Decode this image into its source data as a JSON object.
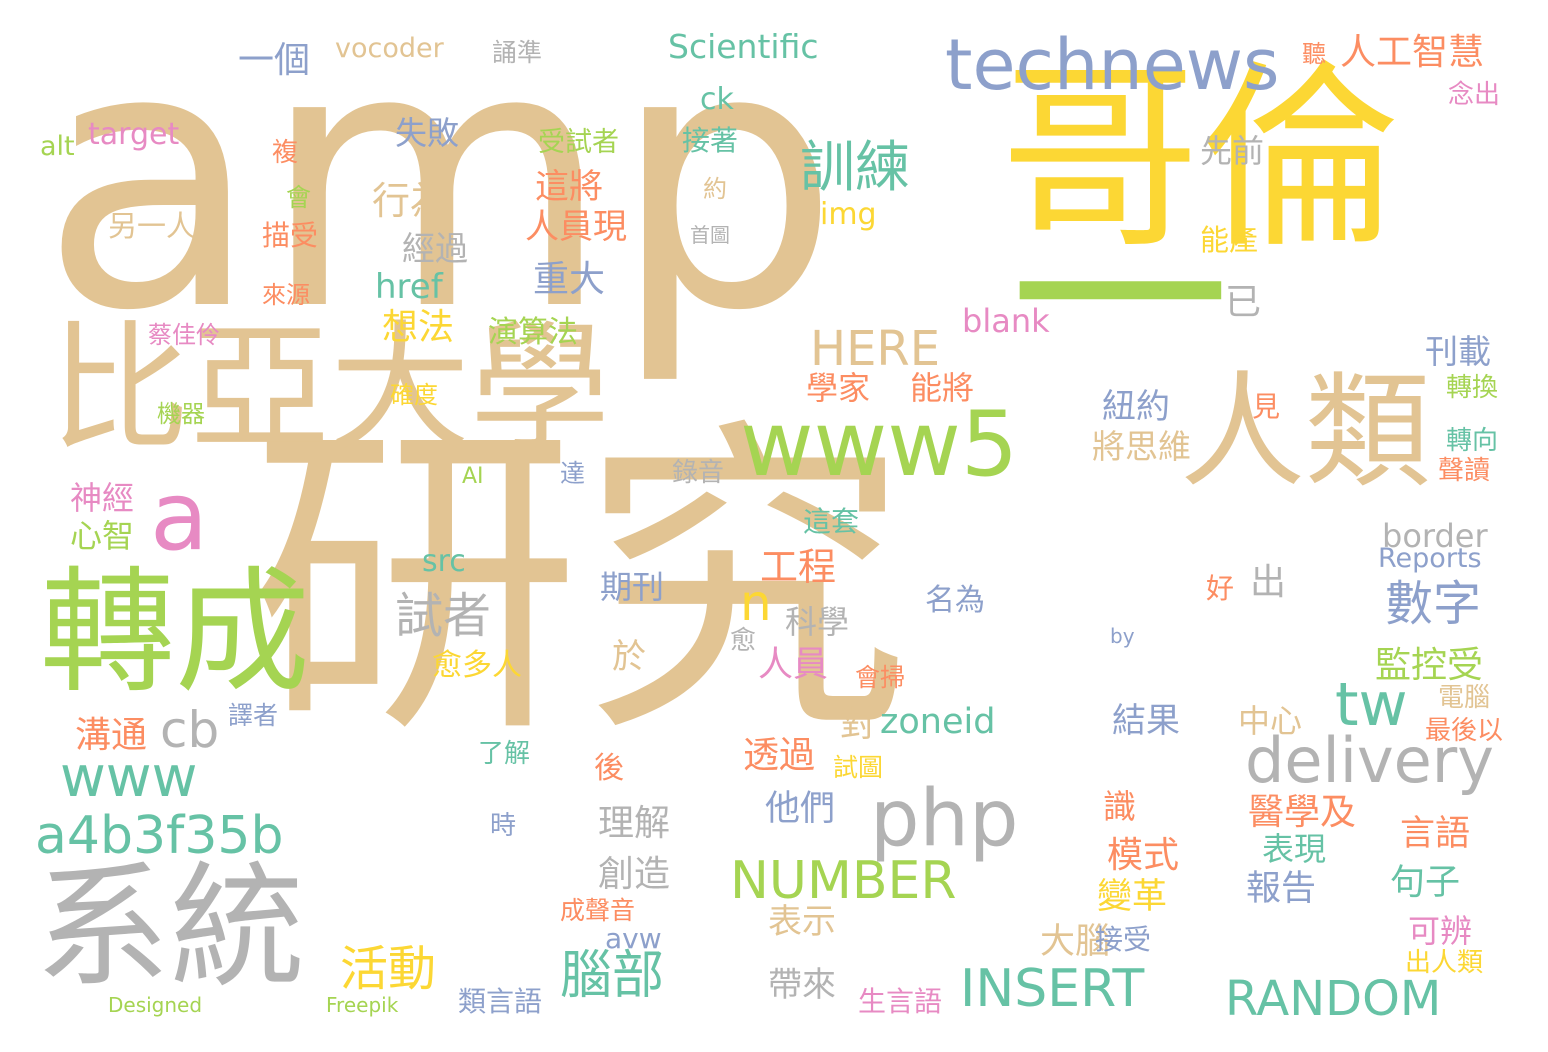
{
  "colors": {
    "background": "#ffffff",
    "tan": "#e2c493",
    "yellow": "#fcd734",
    "green": "#a5d452",
    "teal": "#66c2a5",
    "blue": "#8da0cb",
    "pink": "#e78ac3",
    "orange": "#fc8d62",
    "gray": "#b3b3b3"
  },
  "words": [
    {
      "text": "amp",
      "color": "#e2c493"
    },
    {
      "text": "研究",
      "color": "#e2c493"
    },
    {
      "text": "哥倫",
      "color": "#fcd734"
    },
    {
      "text": "比亞大學",
      "color": "#e2c493"
    },
    {
      "text": "一",
      "color": "#a5d452"
    },
    {
      "text": "人類",
      "color": "#e2c493"
    },
    {
      "text": "www5",
      "color": "#a5d452"
    },
    {
      "text": "technews",
      "color": "#8da0cb"
    },
    {
      "text": "轉成",
      "color": "#a5d452"
    },
    {
      "text": "系統",
      "color": "#b3b3b3"
    },
    {
      "text": "a",
      "color": "#e78ac3"
    },
    {
      "text": "delivery",
      "color": "#b3b3b3"
    },
    {
      "text": "php",
      "color": "#b3b3b3"
    },
    {
      "text": "a4b3f35b",
      "color": "#66c2a5"
    },
    {
      "text": "www",
      "color": "#66c2a5"
    },
    {
      "text": "NUMBER",
      "color": "#a5d452"
    },
    {
      "text": "INSERT",
      "color": "#66c2a5"
    },
    {
      "text": "RANDOM",
      "color": "#66c2a5"
    },
    {
      "text": "tw",
      "color": "#66c2a5"
    },
    {
      "text": "n",
      "color": "#fcd734"
    },
    {
      "text": "cb",
      "color": "#b3b3b3"
    },
    {
      "text": "訓練",
      "color": "#66c2a5"
    },
    {
      "text": "數字",
      "color": "#8da0cb"
    },
    {
      "text": "HERE",
      "color": "#e2c493"
    },
    {
      "text": "腦部",
      "color": "#66c2a5"
    },
    {
      "text": "活動",
      "color": "#fcd734"
    },
    {
      "text": "試者",
      "color": "#b3b3b3"
    },
    {
      "text": "zoneid",
      "color": "#66c2a5"
    },
    {
      "text": "Scientific",
      "color": "#66c2a5"
    },
    {
      "text": "人工智慧",
      "color": "#fc8d62"
    },
    {
      "text": "vocoder",
      "color": "#e2c493"
    },
    {
      "text": "一個",
      "color": "#8da0cb"
    },
    {
      "text": "target",
      "color": "#e78ac3"
    },
    {
      "text": "alt",
      "color": "#a5d452"
    },
    {
      "text": "失敗",
      "color": "#8da0cb"
    },
    {
      "text": "ck",
      "color": "#66c2a5"
    },
    {
      "text": "受試者",
      "color": "#a5d452"
    },
    {
      "text": "接著",
      "color": "#66c2a5"
    },
    {
      "text": "這將",
      "color": "#fc8d62"
    },
    {
      "text": "行為",
      "color": "#e2c493"
    },
    {
      "text": "人員現",
      "color": "#fc8d62"
    },
    {
      "text": "經過",
      "color": "#b3b3b3"
    },
    {
      "text": "img",
      "color": "#fcd734"
    },
    {
      "text": "href",
      "color": "#66c2a5"
    },
    {
      "text": "重大",
      "color": "#8da0cb"
    },
    {
      "text": "想法",
      "color": "#fcd734"
    },
    {
      "text": "演算法",
      "color": "#a5d452"
    },
    {
      "text": "blank",
      "color": "#e78ac3"
    },
    {
      "text": "已",
      "color": "#b3b3b3"
    },
    {
      "text": "學家",
      "color": "#fc8d62"
    },
    {
      "text": "能將",
      "color": "#fc8d62"
    },
    {
      "text": "紐約",
      "color": "#8da0cb"
    },
    {
      "text": "將思維",
      "color": "#e2c493"
    },
    {
      "text": "刊載",
      "color": "#8da0cb"
    },
    {
      "text": "見",
      "color": "#fc8d62"
    },
    {
      "text": "轉換",
      "color": "#a5d452"
    },
    {
      "text": "轉向",
      "color": "#66c2a5"
    },
    {
      "text": "聲讀",
      "color": "#fc8d62"
    },
    {
      "text": "神經",
      "color": "#e78ac3"
    },
    {
      "text": "心智",
      "color": "#a5d452"
    },
    {
      "text": "src",
      "color": "#66c2a5"
    },
    {
      "text": "工程",
      "color": "#fc8d62"
    },
    {
      "text": "期刊",
      "color": "#8da0cb"
    },
    {
      "text": "科學",
      "color": "#b3b3b3"
    },
    {
      "text": "人員",
      "color": "#e78ac3"
    },
    {
      "text": "出",
      "color": "#b3b3b3"
    },
    {
      "text": "border",
      "color": "#b3b3b3"
    },
    {
      "text": "Reports",
      "color": "#8da0cb"
    },
    {
      "text": "監控受",
      "color": "#a5d452"
    },
    {
      "text": "好",
      "color": "#fc8d62"
    },
    {
      "text": "名為",
      "color": "#8da0cb"
    },
    {
      "text": "by",
      "color": "#8da0cb"
    },
    {
      "text": "於",
      "color": "#e2c493"
    },
    {
      "text": "愈多人",
      "color": "#fcd734"
    },
    {
      "text": "愈",
      "color": "#b3b3b3"
    },
    {
      "text": "對",
      "color": "#e2c493"
    },
    {
      "text": "結果",
      "color": "#8da0cb"
    },
    {
      "text": "中心",
      "color": "#e2c493"
    },
    {
      "text": "溝通",
      "color": "#fc8d62"
    },
    {
      "text": "譯者",
      "color": "#8da0cb"
    },
    {
      "text": "了解",
      "color": "#66c2a5"
    },
    {
      "text": "後",
      "color": "#fc8d62"
    },
    {
      "text": "透過",
      "color": "#fc8d62"
    },
    {
      "text": "會掃",
      "color": "#fc8d62"
    },
    {
      "text": "電腦",
      "color": "#e2c493"
    },
    {
      "text": "最後以",
      "color": "#fc8d62"
    },
    {
      "text": "試圖",
      "color": "#fcd734"
    },
    {
      "text": "他們",
      "color": "#8da0cb"
    },
    {
      "text": "理解",
      "color": "#b3b3b3"
    },
    {
      "text": "時",
      "color": "#8da0cb"
    },
    {
      "text": "識",
      "color": "#fc8d62"
    },
    {
      "text": "醫學及",
      "color": "#fc8d62"
    },
    {
      "text": "言語",
      "color": "#fc8d62"
    },
    {
      "text": "模式",
      "color": "#fc8d62"
    },
    {
      "text": "表現",
      "color": "#66c2a5"
    },
    {
      "text": "句子",
      "color": "#66c2a5"
    },
    {
      "text": "創造",
      "color": "#b3b3b3"
    },
    {
      "text": "報告",
      "color": "#8da0cb"
    },
    {
      "text": "變革",
      "color": "#fcd734"
    },
    {
      "text": "表示",
      "color": "#e2c493"
    },
    {
      "text": "成聲音",
      "color": "#fc8d62"
    },
    {
      "text": "avw",
      "color": "#8da0cb"
    },
    {
      "text": "大腦",
      "color": "#e2c493"
    },
    {
      "text": "接受",
      "color": "#8da0cb"
    },
    {
      "text": "可辨",
      "color": "#e78ac3"
    },
    {
      "text": "出人類",
      "color": "#fcd734"
    },
    {
      "text": "帶來",
      "color": "#b3b3b3"
    },
    {
      "text": "類言語",
      "color": "#8da0cb"
    },
    {
      "text": "生言語",
      "color": "#e78ac3"
    },
    {
      "text": "Designed",
      "color": "#a5d452"
    },
    {
      "text": "Freepik",
      "color": "#a5d452"
    },
    {
      "text": "誦準",
      "color": "#b3b3b3"
    },
    {
      "text": "聽",
      "color": "#fc8d62"
    },
    {
      "text": "念出",
      "color": "#e78ac3"
    },
    {
      "text": "先前",
      "color": "#b3b3b3"
    },
    {
      "text": "約",
      "color": "#e2c493"
    },
    {
      "text": "首圖",
      "color": "#b3b3b3"
    },
    {
      "text": "能產",
      "color": "#fcd734"
    },
    {
      "text": "複",
      "color": "#fc8d62"
    },
    {
      "text": "會",
      "color": "#a5d452"
    },
    {
      "text": "另一人",
      "color": "#e2c493"
    },
    {
      "text": "描受",
      "color": "#fc8d62"
    },
    {
      "text": "來源",
      "color": "#fc8d62"
    },
    {
      "text": "蔡佳伶",
      "color": "#e78ac3"
    },
    {
      "text": "機器",
      "color": "#a5d452"
    },
    {
      "text": "確度",
      "color": "#fcd734"
    },
    {
      "text": "AI",
      "color": "#a5d452"
    },
    {
      "text": "達",
      "color": "#8da0cb"
    },
    {
      "text": "錄音",
      "color": "#b3b3b3"
    },
    {
      "text": "這套",
      "color": "#66c2a5"
    }
  ]
}
